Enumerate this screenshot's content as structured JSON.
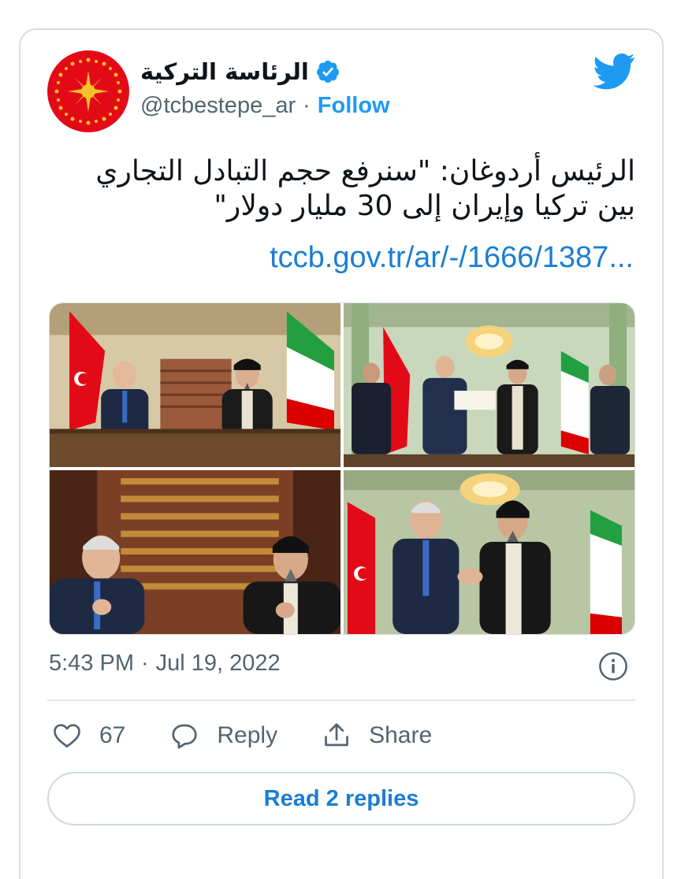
{
  "author": {
    "display_name": "الرئاسة التركية",
    "handle": "@tcbestepe_ar",
    "separator": "·",
    "follow_label": "Follow",
    "verified": true
  },
  "tweet": {
    "text_line1": "الرئيس أردوغان: \"سنرفع حجم التبادل التجاري",
    "text_line2": "بين تركيا وإيران إلى 30 مليار دولار\"",
    "link": "tccb.gov.tr/ar/-/1666/1387..."
  },
  "media": {
    "photo_count": 4
  },
  "meta": {
    "time": "5:43 PM",
    "separator": "·",
    "date": "Jul 19, 2022"
  },
  "actions": {
    "like_count": "67",
    "reply_label": "Reply",
    "share_label": "Share"
  },
  "read_replies_label": "Read 2 replies",
  "colors": {
    "accent": "#1d9bf0",
    "link": "#1b7ed1",
    "muted": "#536471",
    "avatar_red": "#e30a17",
    "avatar_gold": "#f3c12a"
  },
  "icons": [
    "verified-badge-icon",
    "twitter-bird-icon",
    "info-icon",
    "heart-icon",
    "reply-bubble-icon",
    "share-icon"
  ]
}
